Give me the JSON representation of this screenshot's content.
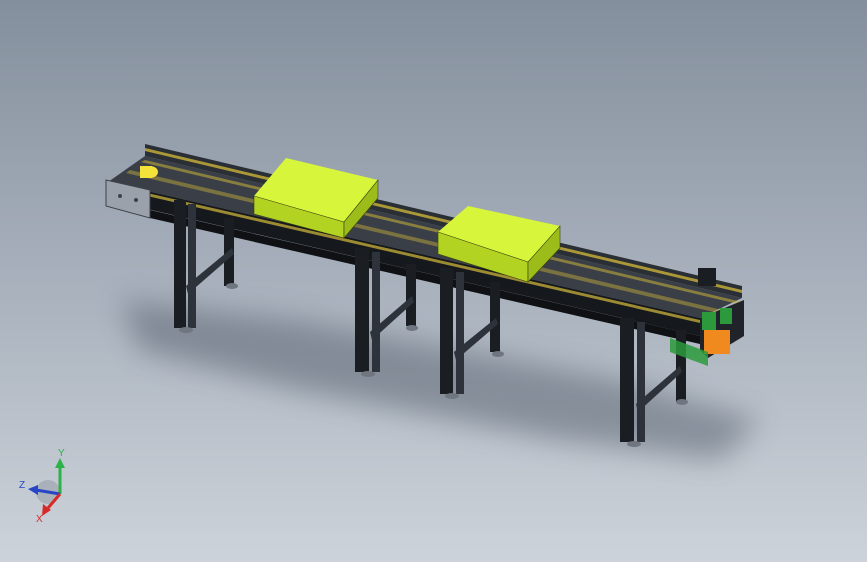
{
  "viewport": {
    "background_top": "#848f9d",
    "background_bottom": "#cdd3da"
  },
  "model": {
    "frame_color": "#1c1f24",
    "belt_highlight": "#c9b23a",
    "box_color": "#c4e62a",
    "roller_color": "#f2e23a",
    "motor_accent": "#f08a1e",
    "motor_green": "#2c9a3c"
  },
  "triad": {
    "x_label": "X",
    "y_label": "Y",
    "z_label": "Z",
    "x_color": "#d62a2a",
    "y_color": "#2bb24a",
    "z_color": "#2746c7"
  }
}
